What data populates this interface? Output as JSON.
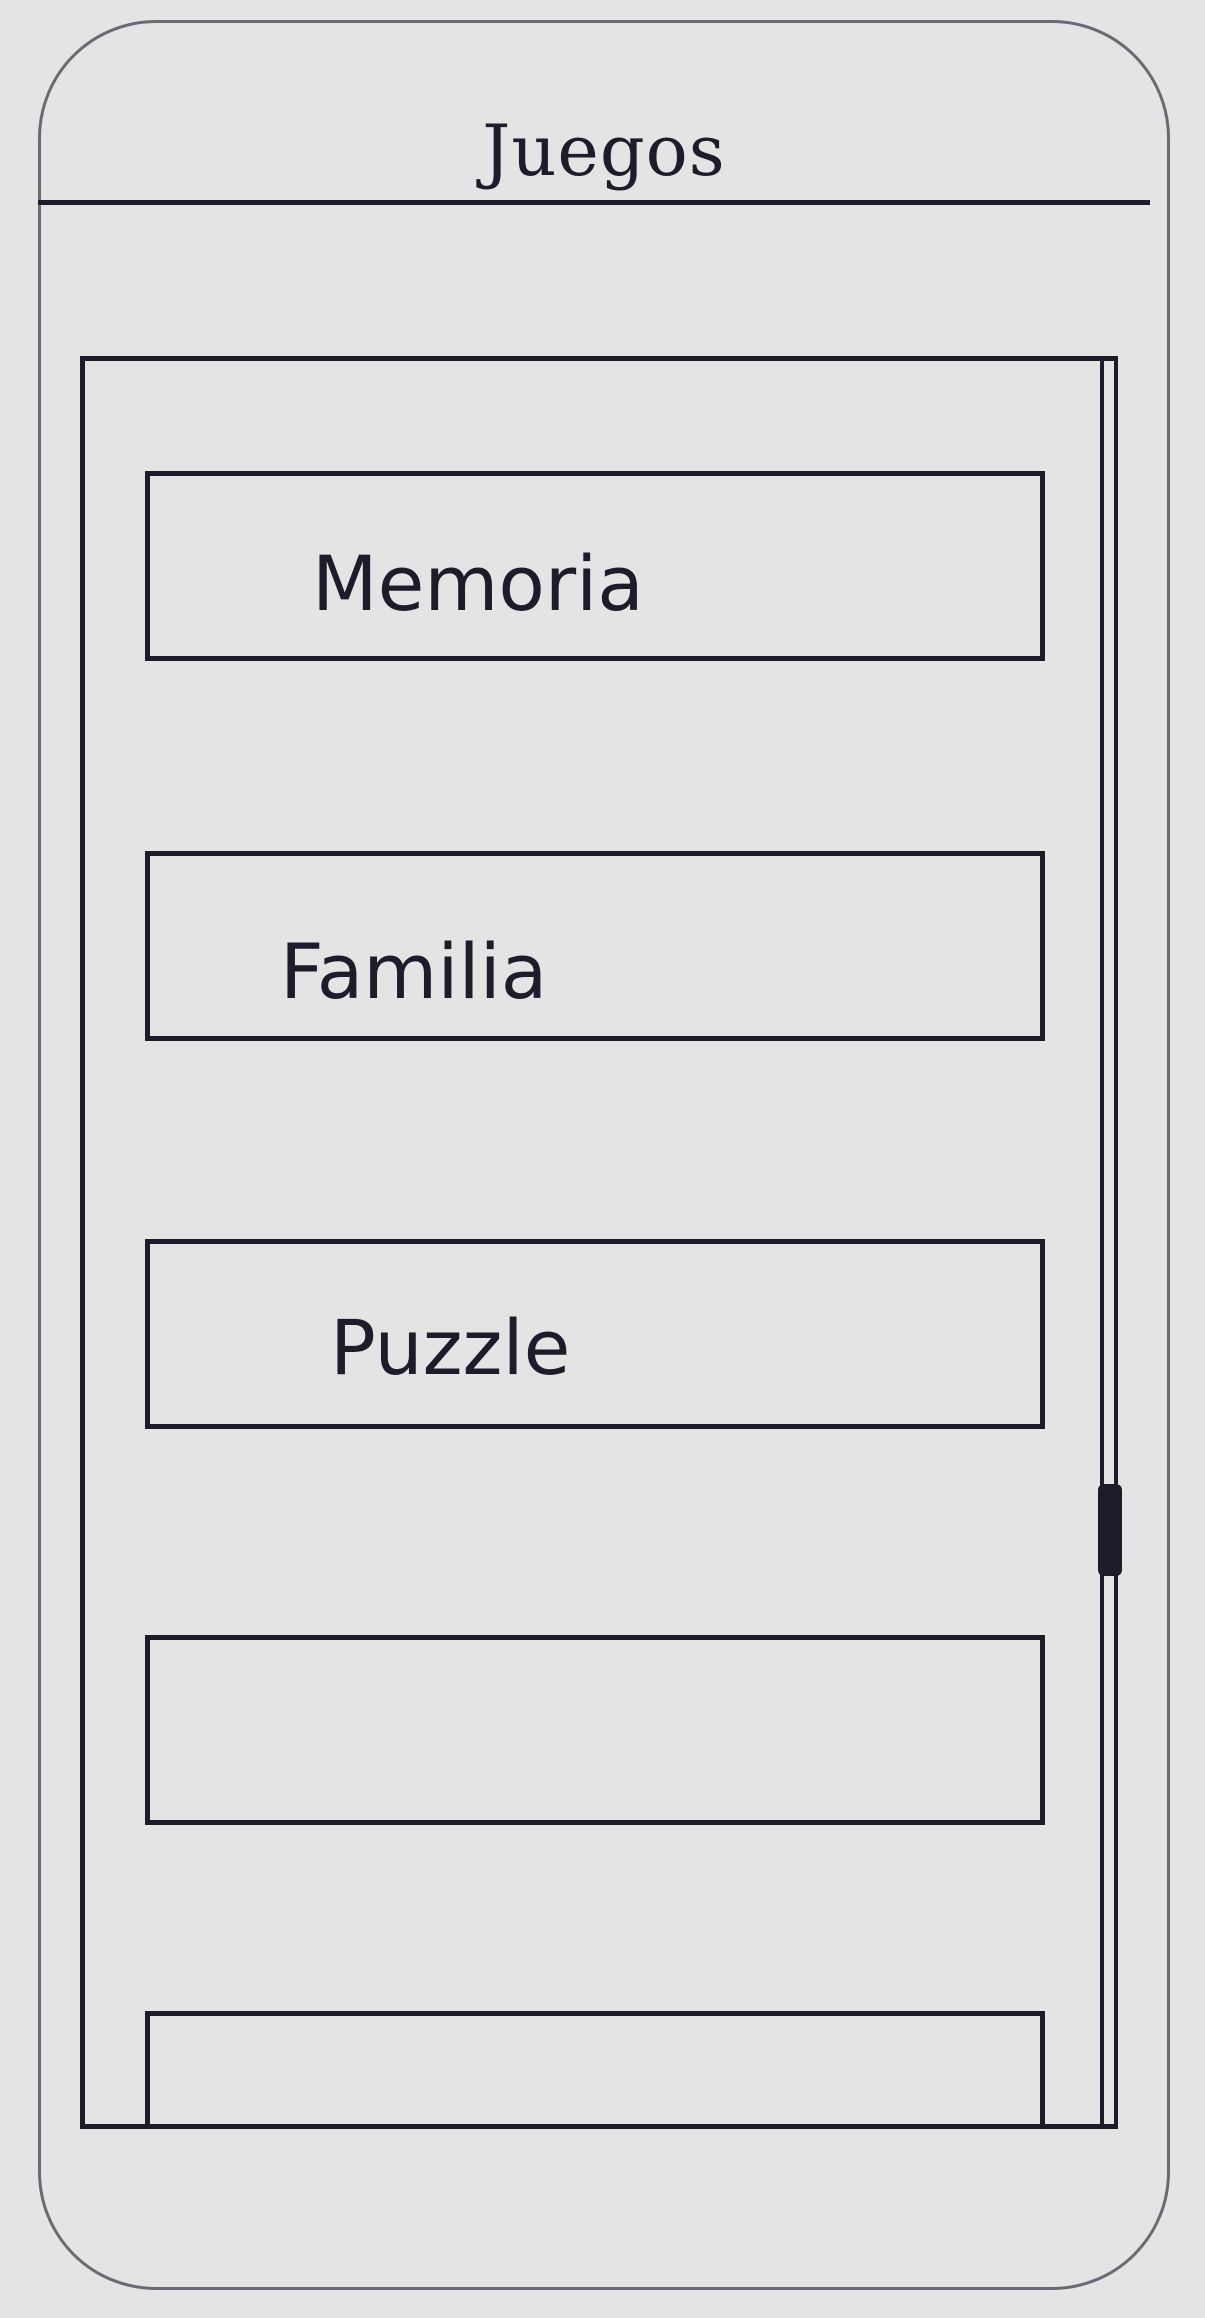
{
  "header": {
    "title": "Juegos"
  },
  "games": [
    {
      "label": "Memoria"
    },
    {
      "label": "Familia"
    },
    {
      "label": "Puzzle"
    },
    {
      "label": ""
    },
    {
      "label": ""
    }
  ],
  "colors": {
    "background": "#e4e4e4",
    "ink": "#1c1c2a"
  }
}
